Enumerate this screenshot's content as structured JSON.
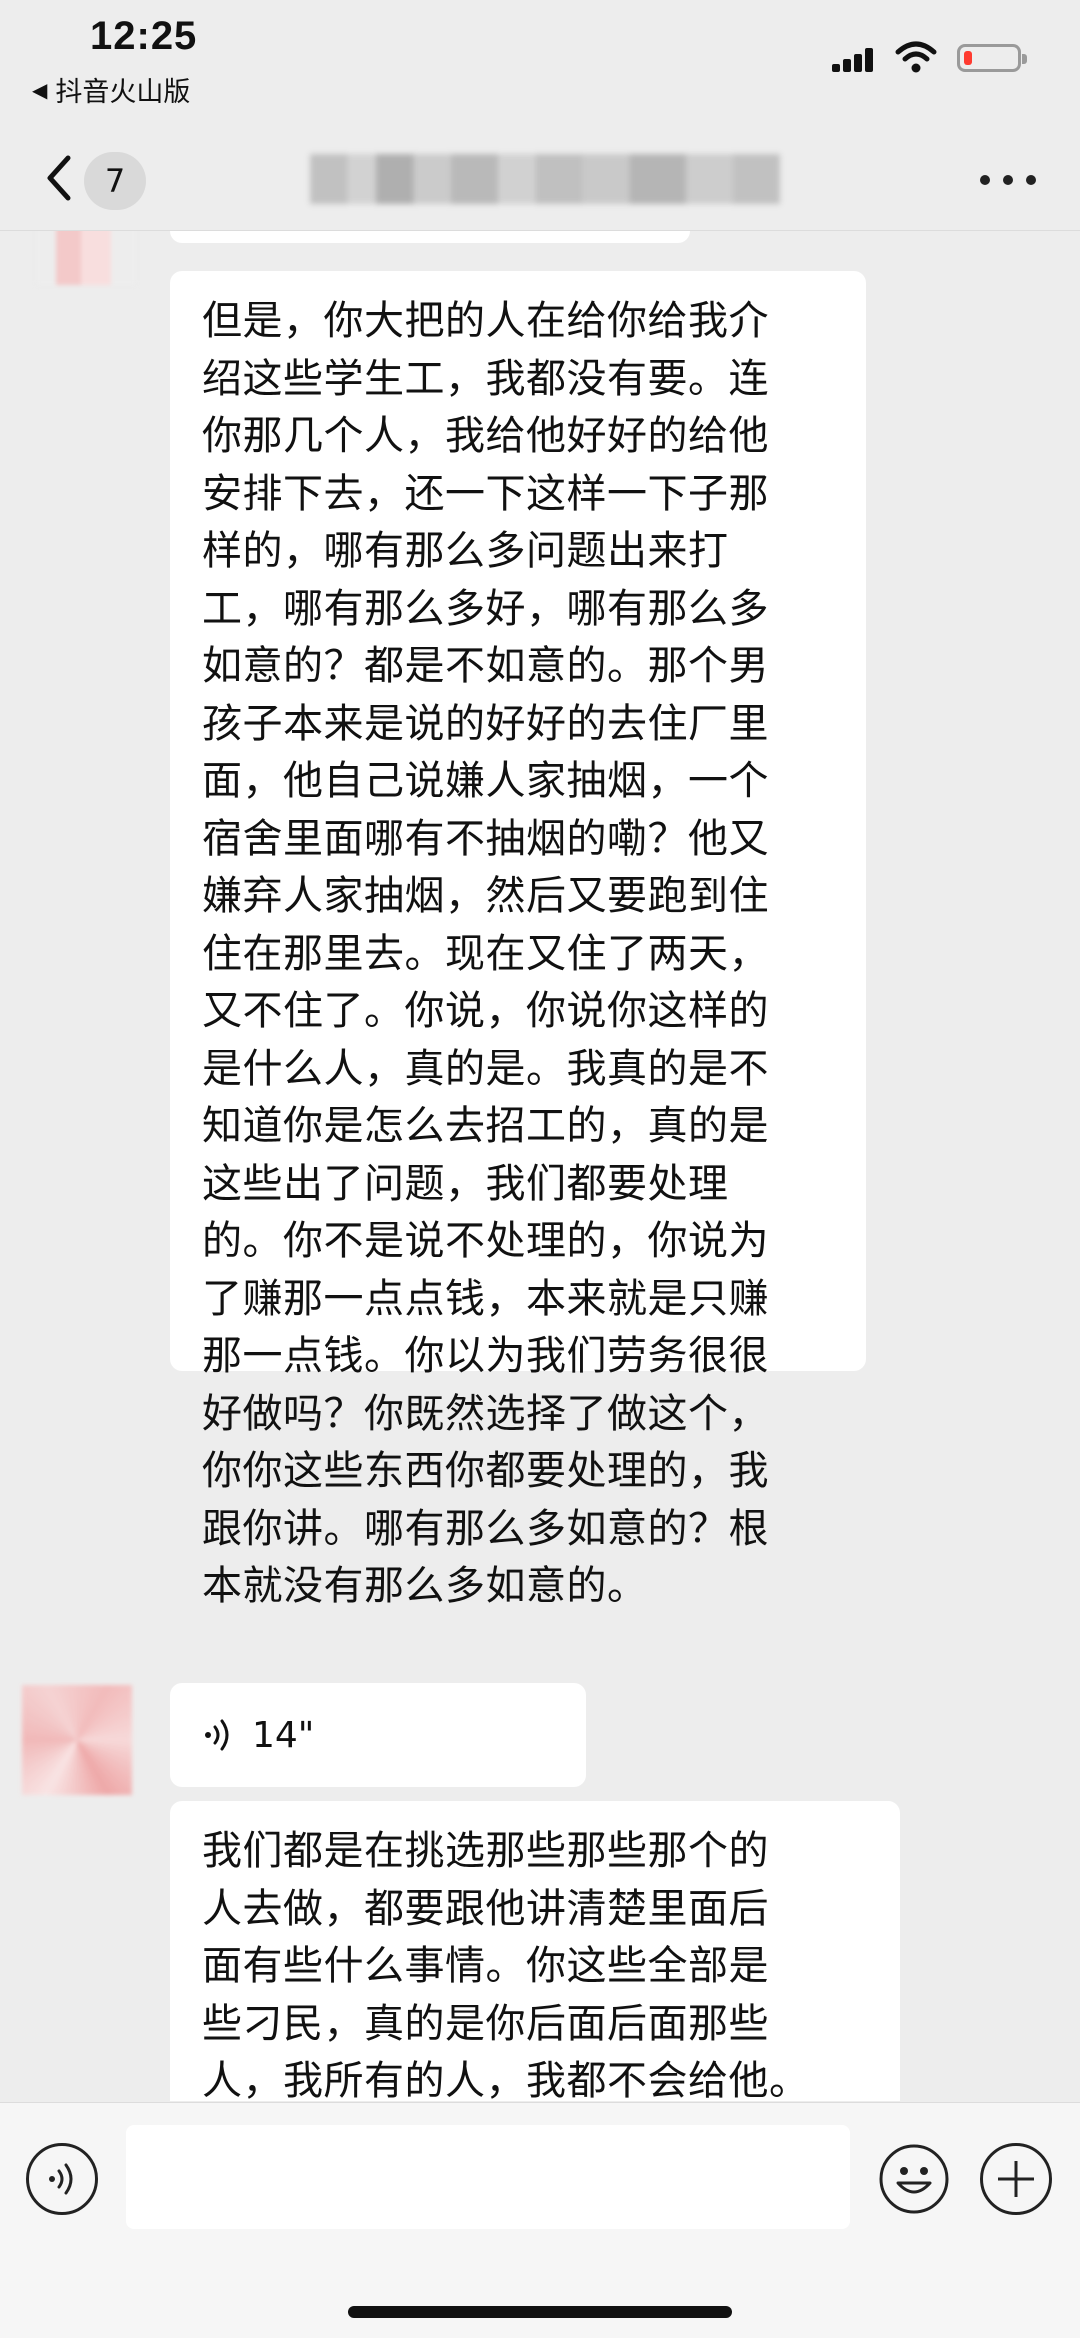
{
  "status_bar": {
    "time": "12:25",
    "back_app": "抖音火山版",
    "battery_color": "#ff3b30"
  },
  "nav": {
    "unread_count": "7",
    "back_icon": "chevron-left-icon",
    "more_icon": "more-dots-icon"
  },
  "messages": [
    {
      "type": "text",
      "text": "但是，你大把的人在给你给我介\n绍这些学生工，我都没有要。连\n你那几个人，我给他好好的给他\n安排下去，还一下这样一下子那\n样的，哪有那么多问题出来打\n工，哪有那么多好，哪有那么多\n如意的？都是不如意的。那个男\n孩子本来是说的好好的去住厂里\n面，他自己说嫌人家抽烟，一个\n宿舍里面哪有不抽烟的嘞？他又\n嫌弃人家抽烟，然后又要跑到住\n住在那里去。现在又住了两天，\n又不住了。你说，你说你这样的\n是什么人，真的是。我真的是不\n知道你是怎么去招工的，真的是\n这些出了问题，我们都要处理\n的。你不是说不处理的，你说为\n了赚那一点点钱，本来就是只赚\n那一点钱。你以为我们劳务很很\n好做吗？你既然选择了做这个，\n你你这些东西你都要处理的，我\n跟你讲。哪有那么多如意的？根\n本就没有那么多如意的。"
    },
    {
      "type": "voice",
      "duration": "14\""
    },
    {
      "type": "text",
      "text": "我们都是在挑选那些那些那个的\n人去做，都要跟他讲清楚里面后\n面有些什么事情。你这些全部是\n些刁民，真的是你后面后面那些\n人，我所有的人，我都不会给他。"
    }
  ],
  "input_bar": {
    "voice_icon": "voice-input-icon",
    "emoji_icon": "emoji-icon",
    "plus_icon": "plus-icon"
  }
}
